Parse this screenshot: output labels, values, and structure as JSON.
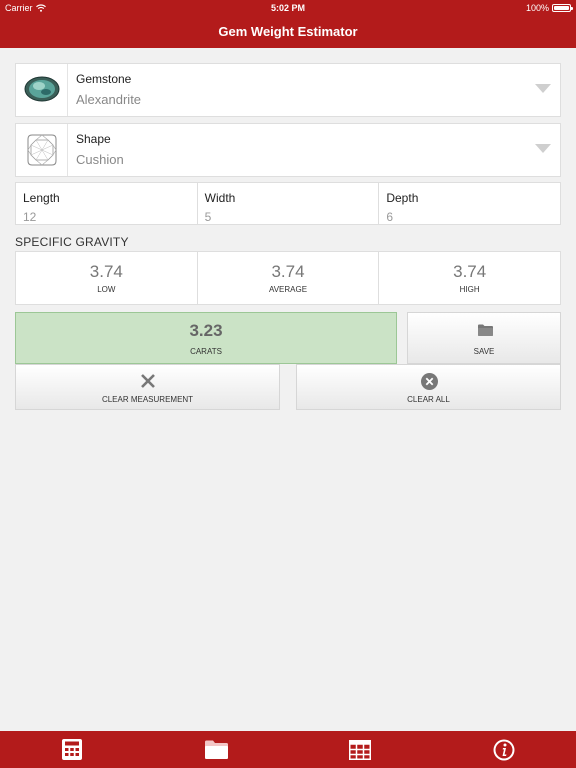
{
  "status_bar": {
    "carrier": "Carrier",
    "time": "5:02 PM",
    "battery": "100%"
  },
  "header": {
    "title": "Gem Weight Estimator"
  },
  "gemstone": {
    "label": "Gemstone",
    "value": "Alexandrite"
  },
  "shape": {
    "label": "Shape",
    "value": "Cushion"
  },
  "measurements": [
    {
      "label": "Length",
      "value": "12"
    },
    {
      "label": "Width",
      "value": "5"
    },
    {
      "label": "Depth",
      "value": "6"
    }
  ],
  "specific_gravity": {
    "heading": "SPECIFIC GRAVITY",
    "low": {
      "value": "3.74",
      "label": "LOW"
    },
    "average": {
      "value": "3.74",
      "label": "AVERAGE"
    },
    "high": {
      "value": "3.74",
      "label": "HIGH"
    }
  },
  "result": {
    "value": "3.23",
    "label": "CARATS"
  },
  "buttons": {
    "save": "SAVE",
    "clear_measurement": "CLEAR MEASUREMENT",
    "clear_all": "CLEAR ALL"
  },
  "tabs": [
    {
      "icon": "calculator-icon"
    },
    {
      "icon": "folder-icon"
    },
    {
      "icon": "table-icon"
    },
    {
      "icon": "info-icon"
    }
  ],
  "colors": {
    "accent": "#b31b1b",
    "result_bg": "#cbe3c6",
    "background": "#f1f1f1"
  }
}
